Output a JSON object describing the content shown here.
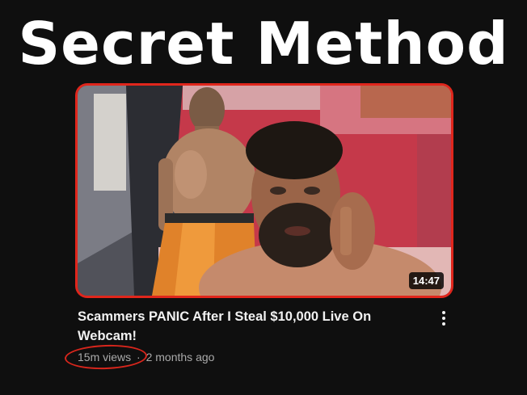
{
  "headline": "Secret Method",
  "video": {
    "duration": "14:47",
    "title": "Scammers PANIC After I Steal $10,000 Live On Webcam!",
    "views": "15m views",
    "separator": "·",
    "uploaded": "2 months ago"
  },
  "icons": {
    "more": "more-vert-icon"
  },
  "colors": {
    "background": "#0f0f0f",
    "highlight": "#e0261c",
    "meta_text": "#aaaaaa"
  }
}
